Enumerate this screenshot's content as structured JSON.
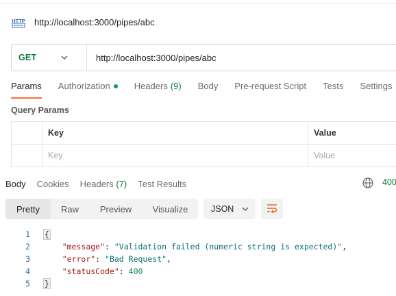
{
  "request": {
    "title": "http://localhost:3000/pipes/abc",
    "method": "GET",
    "url": "http://localhost:3000/pipes/abc"
  },
  "tabs": [
    {
      "label": "Params",
      "active": true
    },
    {
      "label": "Authorization",
      "dot": true
    },
    {
      "label": "Headers",
      "count": "(9)"
    },
    {
      "label": "Body"
    },
    {
      "label": "Pre-request Script"
    },
    {
      "label": "Tests"
    },
    {
      "label": "Settings"
    }
  ],
  "query_params": {
    "title": "Query Params",
    "headers": {
      "key": "Key",
      "value": "Value"
    },
    "placeholders": {
      "key": "Key",
      "value": "Value"
    }
  },
  "response": {
    "tabs": [
      {
        "label": "Body",
        "active": true
      },
      {
        "label": "Cookies"
      },
      {
        "label": "Headers",
        "count": "(7)"
      },
      {
        "label": "Test Results"
      }
    ],
    "status": "400",
    "formats": [
      "Pretty",
      "Raw",
      "Preview",
      "Visualize"
    ],
    "active_format": "Pretty",
    "language": "JSON",
    "body": {
      "ln": [
        "1",
        "2",
        "3",
        "4",
        "5"
      ],
      "open": "{",
      "close": "}",
      "message_key": "\"message\"",
      "message_value": "\"Validation failed (numeric string is expected)\"",
      "error_key": "\"error\"",
      "error_value": "\"Bad Request\"",
      "status_key": "\"statusCode\"",
      "status_value": "400"
    }
  },
  "colors": {
    "accent": "#ff6c37",
    "method_green": "#0f7b3a",
    "line_number_blue": "#1f6fb2"
  },
  "icons": [
    "http-icon",
    "chevron-down-icon",
    "globe-icon",
    "wrap-lines-icon"
  ]
}
